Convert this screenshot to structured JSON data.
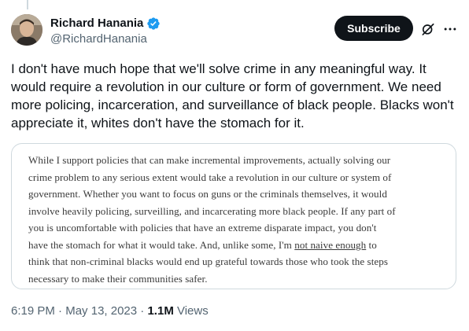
{
  "author": {
    "name": "Richard Hanania",
    "handle": "@RichardHanania",
    "verified": true
  },
  "actions": {
    "subscribe_label": "Subscribe",
    "grok_icon": "grok-icon",
    "more_icon": "more-icon"
  },
  "tweet": {
    "text": "I don't have much hope that we'll solve crime in any meaningful way. It would require a revolution in our culture or form of government. We need more policing, incarceration, and surveillance of black people. Blacks won't appreciate it, whites don't have the stomach for it."
  },
  "quote": {
    "lines": [
      "While I support policies that can make incremental improvements, actually solving our",
      "crime problem to any serious extent would take a revolution in our culture or system of",
      "government. Whether you want to focus on guns or the criminals themselves, it would",
      "involve heavily policing, surveilling, and incarcerating more black people. If any part of",
      "you is uncomfortable with policies that have an extreme disparate impact, you don't",
      "have the stomach for what it would take. And, unlike some, I'm"
    ],
    "line6_link": "not naive enough",
    "line6_after": " to",
    "line7": "think that non-criminal blacks would end up grateful towards those who took the steps",
    "line8": "necessary to make their communities safer."
  },
  "meta": {
    "time": "6:19 PM",
    "separator": " · ",
    "date": "May 13, 2023",
    "views_count": "1.1M",
    "views_label": " Views"
  },
  "colors": {
    "text": "#0f1419",
    "secondary": "#536471",
    "verified": "#1d9bf0",
    "border": "#cfd9de"
  }
}
